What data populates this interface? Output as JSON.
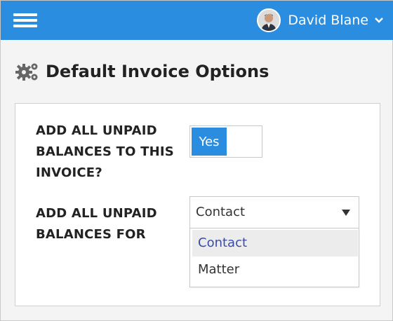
{
  "header": {
    "menu_icon": "hamburger-menu-icon",
    "user_name": "David Blane",
    "chevron_icon": "chevron-down-icon",
    "accent_color": "#2b8de0"
  },
  "page": {
    "title": "Default Invoice Options",
    "title_icon": "gears-icon"
  },
  "form": {
    "add_unpaid_label": "ADD ALL UNPAID BALANCES TO THIS INVOICE?",
    "toggle_value": "Yes",
    "add_unpaid_for_label": "ADD ALL UNPAID BALANCES FOR",
    "select_value": "Contact",
    "options": [
      {
        "label": "Contact",
        "selected": true
      },
      {
        "label": "Matter",
        "selected": false
      }
    ]
  }
}
